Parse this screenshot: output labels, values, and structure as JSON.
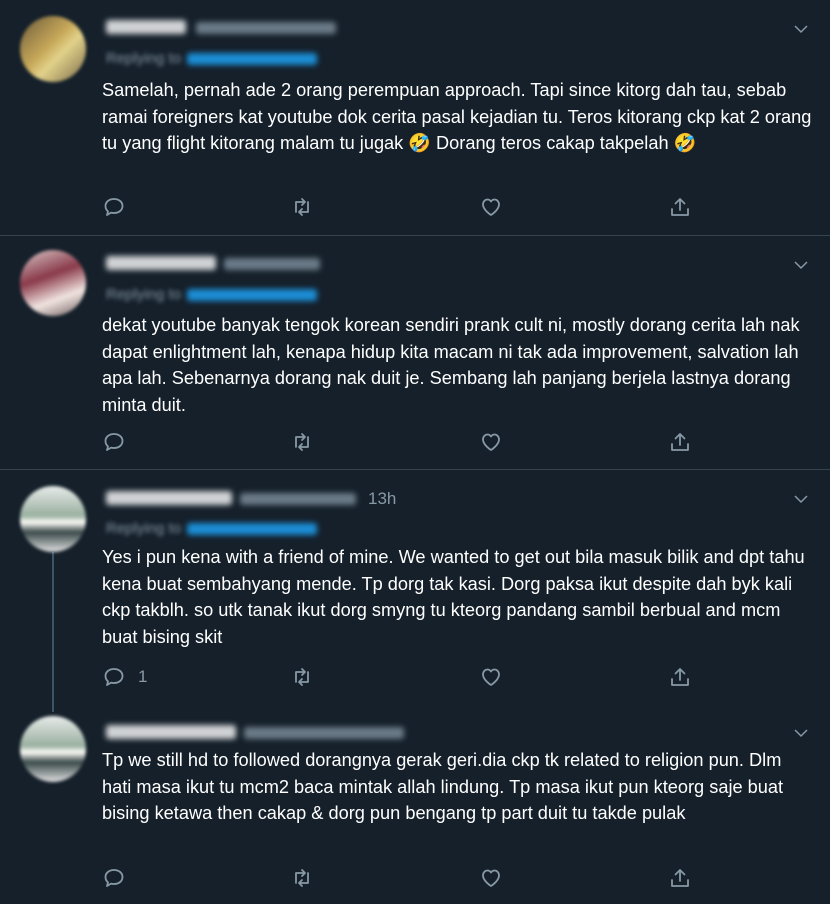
{
  "theme": {
    "background": "#15202b",
    "text": "#ffffff",
    "muted": "#8899a6",
    "accent": "#1da1f2",
    "divider": "#38444d"
  },
  "tweets": [
    {
      "reply_label": "Replying to",
      "time": "",
      "body": "Samelah, pernah ade 2 orang perempuan approach. Tapi since kitorg dah tau, sebab ramai foreigners kat youtube dok cerita pasal kejadian tu. Teros kitorang ckp kat 2 orang tu yang flight kitorang malam tu jugak 🤣 Dorang teros cakap takpelah 🤣",
      "reply_count": ""
    },
    {
      "reply_label": "Replying to",
      "time": "",
      "body": "dekat youtube banyak tengok korean sendiri prank cult ni, mostly dorang cerita lah nak dapat enlightment lah, kenapa hidup kita macam ni tak ada improvement, salvation lah apa lah. Sebenarnya dorang nak duit je. Sembang lah panjang berjela lastnya dorang minta duit.",
      "reply_count": ""
    },
    {
      "reply_label": "Replying to",
      "time": "13h",
      "body": "Yes i pun kena with a friend of mine. We wanted to get out bila masuk bilik and dpt tahu kena buat sembahyang mende. Tp dorg tak kasi. Dorg paksa ikut despite dah byk kali ckp takblh. so utk tanak ikut dorg smyng tu kteorg pandang sambil berbual and mcm buat bising skit",
      "reply_count": "1"
    },
    {
      "reply_label": "",
      "time": "",
      "body": "Tp we still hd to followed dorangnya gerak geri.dia ckp tk related to religion pun. Dlm hati masa ikut tu mcm2 baca mintak allah lindung. Tp masa ikut pun kteorg saje buat bising ketawa then cakap & dorg pun bengang tp part duit tu takde pulak",
      "reply_count": ""
    }
  ]
}
